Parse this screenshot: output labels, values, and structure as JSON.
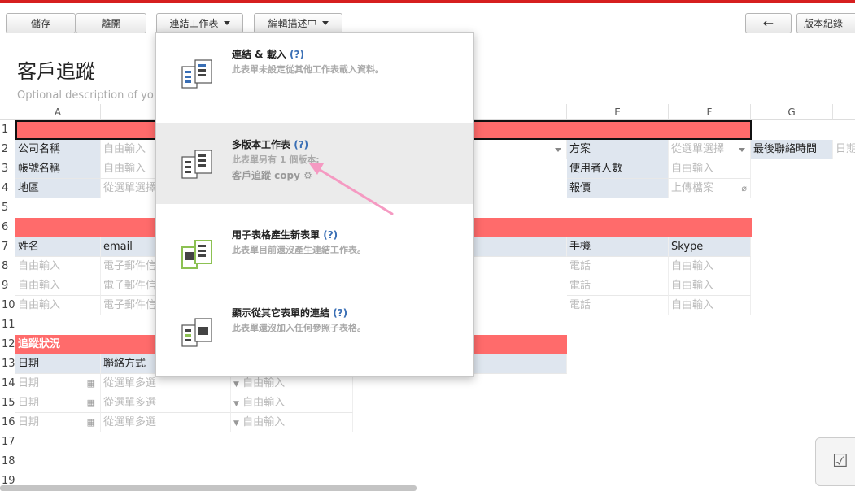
{
  "toolbar": {
    "save": "儲存",
    "leave": "離開",
    "link_sheet": "連結工作表",
    "editing": "編輯描述中",
    "back_icon": "←",
    "version_history": "版本紀錄"
  },
  "page": {
    "title": "客戶追蹤",
    "description": "Optional description of your"
  },
  "columns": [
    "A",
    "E",
    "F",
    "G"
  ],
  "rows": [
    "1",
    "2",
    "3",
    "4",
    "5",
    "6",
    "7",
    "8",
    "9",
    "10",
    "11",
    "12",
    "13",
    "14",
    "15",
    "16",
    "17",
    "18",
    "19"
  ],
  "form": {
    "company": "公司名稱",
    "account": "帳號名稱",
    "region": "地區",
    "free_input": "自由輸入",
    "select_single": "從選單選擇",
    "select_single_f": "從選單選擇",
    "plan": "方案",
    "users": "使用者人數",
    "quote": "報價",
    "upload": "上傳檔案",
    "last_contact": "最後聯絡時間",
    "date_partial": "日期"
  },
  "contacts": {
    "name": "姓名",
    "email": "email",
    "mobile": "手機",
    "skype": "Skype",
    "email_ph": "電子郵件信",
    "phone_ph": "電話"
  },
  "tracking": {
    "section": "追蹤狀況",
    "date": "日期",
    "method": "聯絡方式",
    "date_ph": "日期",
    "multi_ph": "從選單多選"
  },
  "dropdown": {
    "items": [
      {
        "title": "連結 & 載入",
        "q": "(?)",
        "sub": "此表單未設定從其他工作表載入資料。",
        "sub2": ""
      },
      {
        "title": "多版本工作表",
        "q": "(?)",
        "sub": "此表單另有 1 個版本:",
        "sub2": "客戶追蹤 copy"
      },
      {
        "title": "用子表格產生新表單",
        "q": "(?)",
        "sub": "此表單目前還沒產生連結工作表。",
        "sub2": ""
      },
      {
        "title": "顯示從其它表單的連結",
        "q": "(?)",
        "sub": "此表單還沒加入任何參照子表格。",
        "sub2": ""
      }
    ]
  },
  "colors": {
    "accent_red": "#ff6b6b",
    "top_line": "#d61f1f",
    "label_bg": "#dfe6ef",
    "arrow_pink": "#f59ac2",
    "help_blue": "#3a6fb5"
  },
  "icons": [
    "calendar-icon",
    "gear-icon",
    "checkbox-icon",
    "link-sheet-icon"
  ]
}
